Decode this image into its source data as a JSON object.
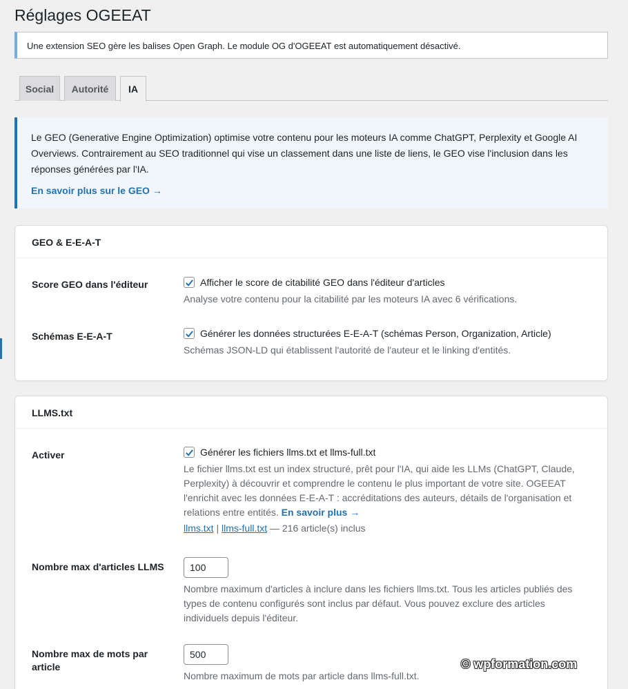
{
  "page_title": "Réglages OGEEAT",
  "notice": "Une extension SEO gère les balises Open Graph. Le module OG d'OGEEAT est automatiquement désactivé.",
  "tabs": [
    {
      "label": "Social",
      "active": false
    },
    {
      "label": "Autorité",
      "active": false
    },
    {
      "label": "IA",
      "active": true
    }
  ],
  "info": {
    "text": "Le GEO (Generative Engine Optimization) optimise votre contenu pour les moteurs IA comme ChatGPT, Perplexity et Google AI Overviews. Contrairement au SEO traditionnel qui vise un classement dans une liste de liens, le GEO vise l'inclusion dans les réponses générées par l'IA.",
    "link": "En savoir plus sur le GEO →"
  },
  "geo_card": {
    "title": "GEO & E-E-A-T",
    "score": {
      "label": "Score GEO dans l'éditeur",
      "checkbox": "Afficher le score de citabilité GEO dans l'éditeur d'articles",
      "checked": true,
      "desc": "Analyse votre contenu pour la citabilité par les moteurs IA avec 6 vérifications."
    },
    "schemas": {
      "label": "Schémas E-E-A-T",
      "checkbox": "Générer les données structurées E-E-A-T (schémas Person, Organization, Article)",
      "checked": true,
      "desc": "Schémas JSON-LD qui établissent l'autorité de l'auteur et le linking d'entités."
    }
  },
  "llms_card": {
    "title": "LLMS.txt",
    "activate": {
      "label": "Activer",
      "checkbox": "Générer les fichiers llms.txt et llms-full.txt",
      "checked": true,
      "desc": "Le fichier llms.txt est un index structuré, prêt pour l'IA, qui aide les LLMs (ChatGPT, Claude, Perplexity) à découvrir et comprendre le contenu le plus important de votre site. OGEEAT l'enrichit avec les données E-E-A-T : accréditations des auteurs, détails de l'organisation et relations entre entités.",
      "desc_link": "En savoir plus →",
      "file1": "llms.txt",
      "sep": "|",
      "file2": "llms-full.txt",
      "count": "— 216 article(s) inclus"
    },
    "max_articles": {
      "label": "Nombre max d'articles LLMS",
      "value": "100",
      "desc": "Nombre maximum d'articles à inclure dans les fichiers llms.txt. Tous les articles publiés des types de contenu configurés sont inclus par défaut. Vous pouvez exclure des articles individuels depuis l'éditeur."
    },
    "max_words": {
      "label": "Nombre max de mots par article",
      "value": "500",
      "desc": "Nombre maximum de mots par article dans llms-full.txt."
    }
  },
  "watermark": "© wpformation.com"
}
